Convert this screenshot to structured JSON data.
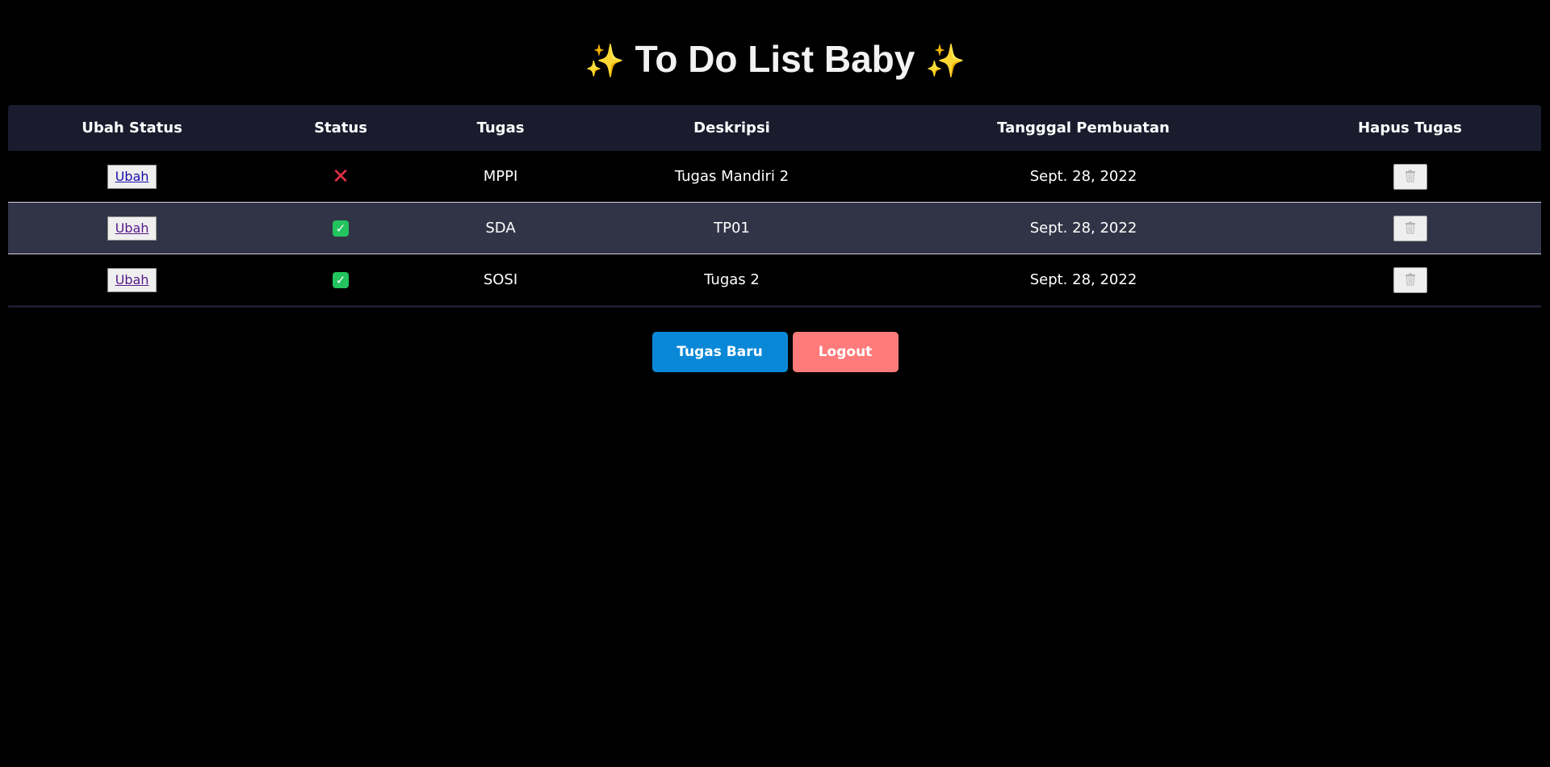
{
  "title": {
    "sparkle_left": "✨",
    "text": "To Do List Baby",
    "sparkle_right": "✨"
  },
  "table": {
    "headers": [
      "Ubah Status",
      "Status",
      "Tugas",
      "Deskripsi",
      "Tangggal Pembuatan",
      "Hapus Tugas"
    ],
    "rows": [
      {
        "action_label": "Ubah",
        "status": "not-done",
        "status_icon": "cross-mark-icon",
        "tugas": "MPPI",
        "deskripsi": "Tugas Mandiri 2",
        "tanggal": "Sept. 28, 2022"
      },
      {
        "action_label": "Ubah",
        "status": "done",
        "status_icon": "check-mark-icon",
        "tugas": "SDA",
        "deskripsi": "TP01",
        "tanggal": "Sept. 28, 2022"
      },
      {
        "action_label": "Ubah",
        "status": "done",
        "status_icon": "check-mark-icon",
        "tugas": "SOSI",
        "deskripsi": "Tugas 2",
        "tanggal": "Sept. 28, 2022"
      }
    ]
  },
  "actions": {
    "new_task_label": "Tugas Baru",
    "logout_label": "Logout"
  },
  "colors": {
    "background": "#000000",
    "header_bg": "#1a1c2e",
    "alt_row_bg": "#313446",
    "new_task_button": "#0a88d8",
    "logout_button": "#ff7b7b",
    "status_done": "#23c45e",
    "status_not_done": "#e8304a",
    "sparkle": "#f5c542"
  }
}
